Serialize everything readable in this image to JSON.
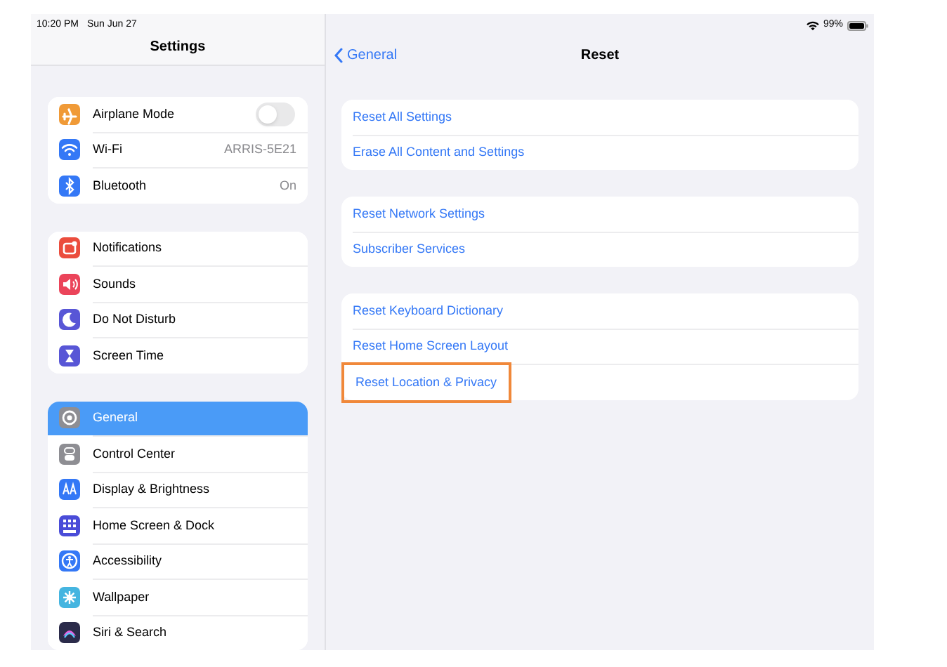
{
  "status_bar": {
    "time": "10:20 PM",
    "date": "Sun Jun 27",
    "battery": "99%"
  },
  "sidebar": {
    "title": "Settings",
    "groups": [
      [
        {
          "label": "Airplane Mode",
          "kind": "toggle",
          "on": false,
          "color": "#f09a37",
          "selected": false
        },
        {
          "label": "Wi-Fi",
          "kind": "value",
          "value": "ARRIS-5E21",
          "color": "#3478f6",
          "selected": false
        },
        {
          "label": "Bluetooth",
          "kind": "value",
          "value": "On",
          "color": "#3478f6",
          "selected": false
        }
      ],
      [
        {
          "label": "Notifications",
          "kind": "plain",
          "color": "#eb4d3d",
          "selected": false
        },
        {
          "label": "Sounds",
          "kind": "plain",
          "color": "#eb445a",
          "selected": false
        },
        {
          "label": "Do Not Disturb",
          "kind": "plain",
          "color": "#5856d6",
          "selected": false
        },
        {
          "label": "Screen Time",
          "kind": "plain",
          "color": "#5856d6",
          "selected": false
        }
      ],
      [
        {
          "label": "General",
          "kind": "plain",
          "color": "#8e8e93",
          "selected": true
        },
        {
          "label": "Control Center",
          "kind": "plain",
          "color": "#8e8e93",
          "selected": false
        },
        {
          "label": "Display & Brightness",
          "kind": "plain",
          "color": "#3478f6",
          "selected": false
        },
        {
          "label": "Home Screen & Dock",
          "kind": "plain",
          "color": "#4a4cd8",
          "selected": false
        },
        {
          "label": "Accessibility",
          "kind": "plain",
          "color": "#3478f6",
          "selected": false
        },
        {
          "label": "Wallpaper",
          "kind": "plain",
          "color": "#45b5e0",
          "selected": false
        },
        {
          "label": "Siri & Search",
          "kind": "plain",
          "color": "#2b2b4a",
          "selected": false
        }
      ]
    ]
  },
  "detail": {
    "back": "General",
    "title": "Reset",
    "groups": [
      [
        {
          "label": "Reset All Settings",
          "highlighted": false
        },
        {
          "label": "Erase All Content and Settings",
          "highlighted": false
        }
      ],
      [
        {
          "label": "Reset Network Settings",
          "highlighted": false
        },
        {
          "label": "Subscriber Services",
          "highlighted": false
        }
      ],
      [
        {
          "label": "Reset Keyboard Dictionary",
          "highlighted": false
        },
        {
          "label": "Reset Home Screen Layout",
          "highlighted": false
        },
        {
          "label": "Reset Location & Privacy",
          "highlighted": true
        }
      ]
    ]
  }
}
